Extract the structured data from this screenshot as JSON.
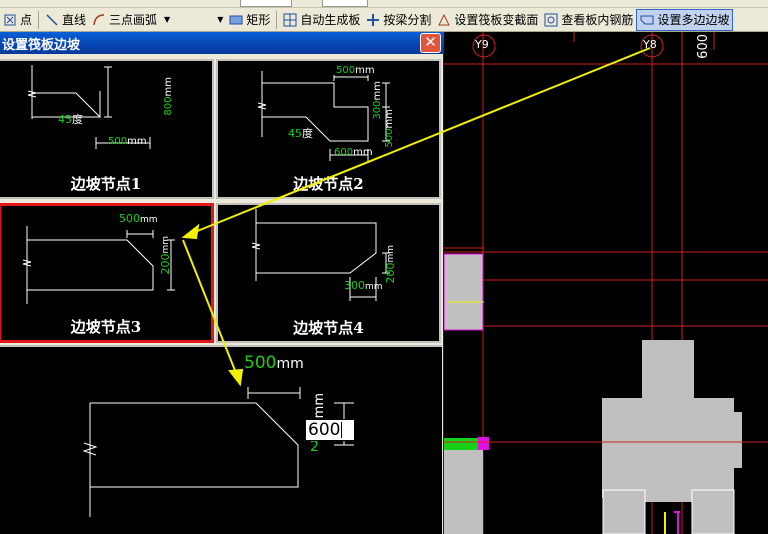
{
  "toolbar": {
    "items": [
      {
        "label": "点",
        "icon": "point-icon"
      },
      {
        "label": "直线",
        "icon": "line-icon"
      },
      {
        "label": "三点画弧",
        "icon": "arc-icon"
      },
      {
        "label": "矩形",
        "icon": "rectangle-icon"
      },
      {
        "label": "自动生成板",
        "icon": "grid-icon"
      },
      {
        "label": "按梁分割",
        "icon": "split-icon"
      },
      {
        "label": "设置筏板变截面",
        "icon": "section-icon"
      },
      {
        "label": "查看板内钢筋",
        "icon": "rebar-icon"
      },
      {
        "label": "设置多边边坡",
        "icon": "slope-icon"
      }
    ]
  },
  "dialog": {
    "title": "设置筏板边坡",
    "close_label": "✕",
    "options": [
      {
        "label": "边坡节点1",
        "dims": {
          "vertical": "800",
          "horizontal": "500",
          "unit": "mm",
          "angle": "45",
          "angle_unit": "度"
        }
      },
      {
        "label": "边坡节点2",
        "dims": {
          "top": "500",
          "side_top": "300",
          "side_bottom": "500",
          "bottom": "600",
          "unit": "mm",
          "angle": "45",
          "angle_unit": "度"
        }
      },
      {
        "label": "边坡节点3",
        "selected": true,
        "dims": {
          "top": "500",
          "side": "200",
          "unit": "mm"
        }
      },
      {
        "label": "边坡节点4",
        "dims": {
          "bottom": "300",
          "side": "200",
          "unit": "mm"
        }
      }
    ],
    "preview": {
      "top_value": "500",
      "unit": "mm",
      "side_input": "600",
      "side_partial": "2"
    }
  },
  "canvas": {
    "axis_labels": [
      "Y9",
      "Y8",
      "600"
    ],
    "colors": {
      "grid": "#d02020",
      "block": "#c0c0c0",
      "arrow": "#f0f000",
      "dim_green": "#18d018",
      "magenta": "#e010e0",
      "selected_border": "#e01818"
    }
  }
}
